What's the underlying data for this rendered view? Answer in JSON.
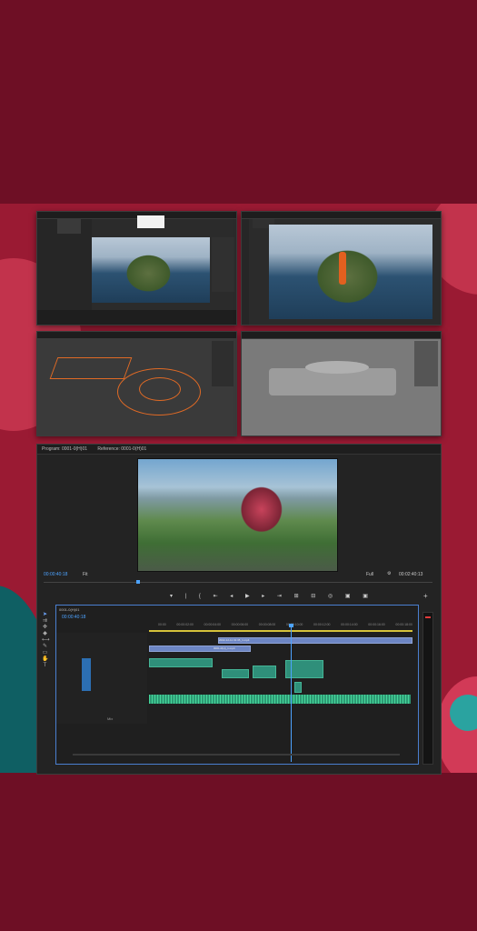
{
  "program_monitor": {
    "tab_program": "Program: 0001-0(H)01",
    "tab_reference": "Reference: 0001-0(H)01",
    "timecode_current": "00:00:40:18",
    "fit_label": "Fit",
    "quality_label": "Full",
    "timecode_duration": "00:02:40:13",
    "transport_controls": "▾ | { ⇤ ◂ ▶ ▸ ⇥ ⊞ ⊟ ◎ ▣ ▣"
  },
  "sequence": {
    "name": "0001-0(H)01",
    "timecode": "00:00:40:18",
    "ruler_labels": [
      "00:00",
      "00:00:02:00",
      "00:00:04:00",
      "00:00:06:00",
      "00:00:08:00",
      "00:00:10:00",
      "00:00:12:00",
      "00:00:14:00",
      "00:00:16:00",
      "00:00:18:00"
    ],
    "clip_v3": "2022-12-11 01:35_1.mp4",
    "clip_v3b": "2022-12-11 01:35_1.mp4",
    "clip_v2": "0001-0(H)_1.mp4",
    "mix_label": "Mix"
  },
  "colors": {
    "accent": "#4da3ff",
    "video_clip": "#6d86c4",
    "audio_clip": "#2d9a74",
    "background": "#6e0f25"
  }
}
